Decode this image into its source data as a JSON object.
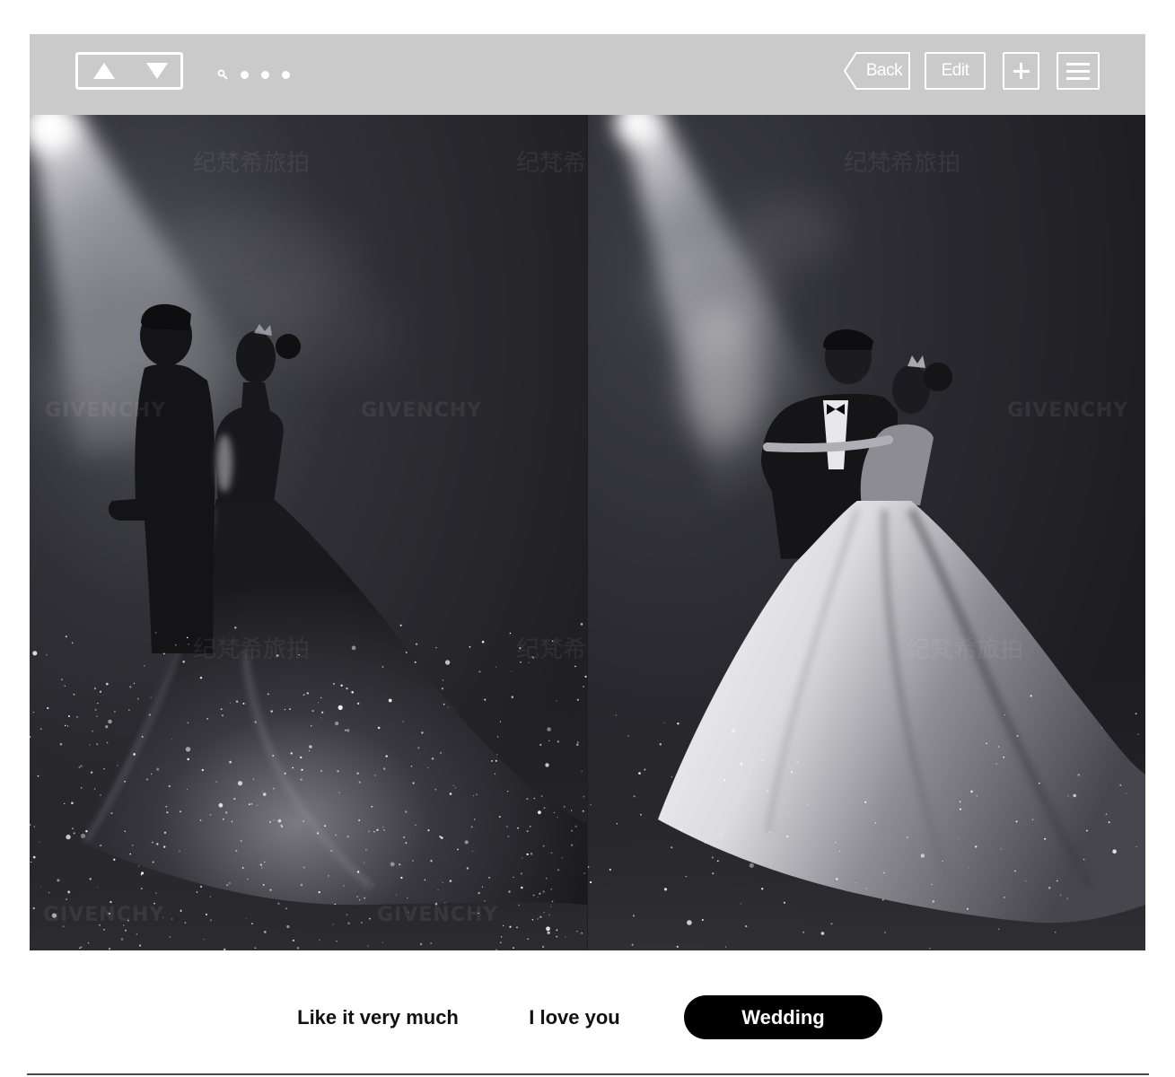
{
  "toolbar": {
    "nav_up_icon": "triangle-up-icon",
    "nav_down_icon": "triangle-down-icon",
    "search_icon": "search-icon",
    "page_dots_count": 3,
    "back_label": "Back",
    "edit_label": "Edit",
    "add_icon": "plus-icon",
    "menu_icon": "menu-icon"
  },
  "gallery": {
    "watermark_cn": "纪梵希旅拍",
    "watermark_en": "GIVENCHY"
  },
  "tabs": [
    {
      "label": "Like it very much",
      "active": false
    },
    {
      "label": "I love you",
      "active": false
    },
    {
      "label": "Wedding",
      "active": true
    }
  ],
  "colors": {
    "toolbar_bg": "#cacaca",
    "toolbar_fg": "#ffffff",
    "active_tab_bg": "#000000",
    "active_tab_text": "#ffffff",
    "tab_text": "#111111",
    "divider": "#4a4a4a"
  }
}
